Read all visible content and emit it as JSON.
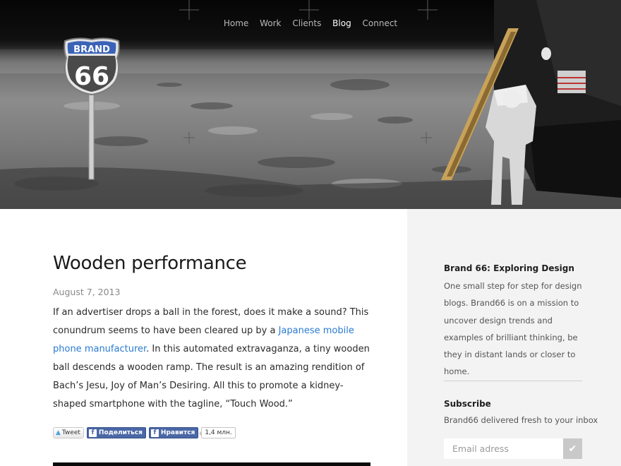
{
  "nav": {
    "items": [
      "Home",
      "Work",
      "Clients",
      "Blog",
      "Connect"
    ],
    "active": "Blog"
  },
  "logo": {
    "top_text": "BRAND",
    "number": "66",
    "icon": "route-66-shield-sign"
  },
  "post": {
    "title": "Wooden performance",
    "date": "August 7, 2013",
    "body_1": "If an advertiser drops a ball in the forest, does it make a sound? This conundrum seems to have been cleared up by a ",
    "link": "Japanese mobile phone manufacturer",
    "body_2": ". In this automated extravaganza, a tiny wooden ball descends a wooden ramp. The result is an amazing rendition of Bach’s Jesu, Joy of Man’s Desiring. All this to promote a kidney-shaped smartphone with the tagline, “Touch Wood.”"
  },
  "share": {
    "tweet": "Tweet",
    "fb_share": "Поделиться",
    "fb_like": "Нравится",
    "count": "1,4 млн."
  },
  "sidebar": {
    "title": "Brand 66: Exploring Design",
    "text": "One small step for step for design blogs. Brand66 is on a mission to uncover design trends and examples of brilliant thinking, be they in distant lands or closer to home.",
    "subscribe_title": "Subscribe",
    "subscribe_text": "Brand66 delivered fresh to your inbox",
    "email_placeholder": "Email adress"
  },
  "colors": {
    "link": "#2a7bd1",
    "sidebar_bg": "#f3f3f3",
    "facebook": "#4a67a6",
    "shield_blue": "#3a63b8"
  }
}
